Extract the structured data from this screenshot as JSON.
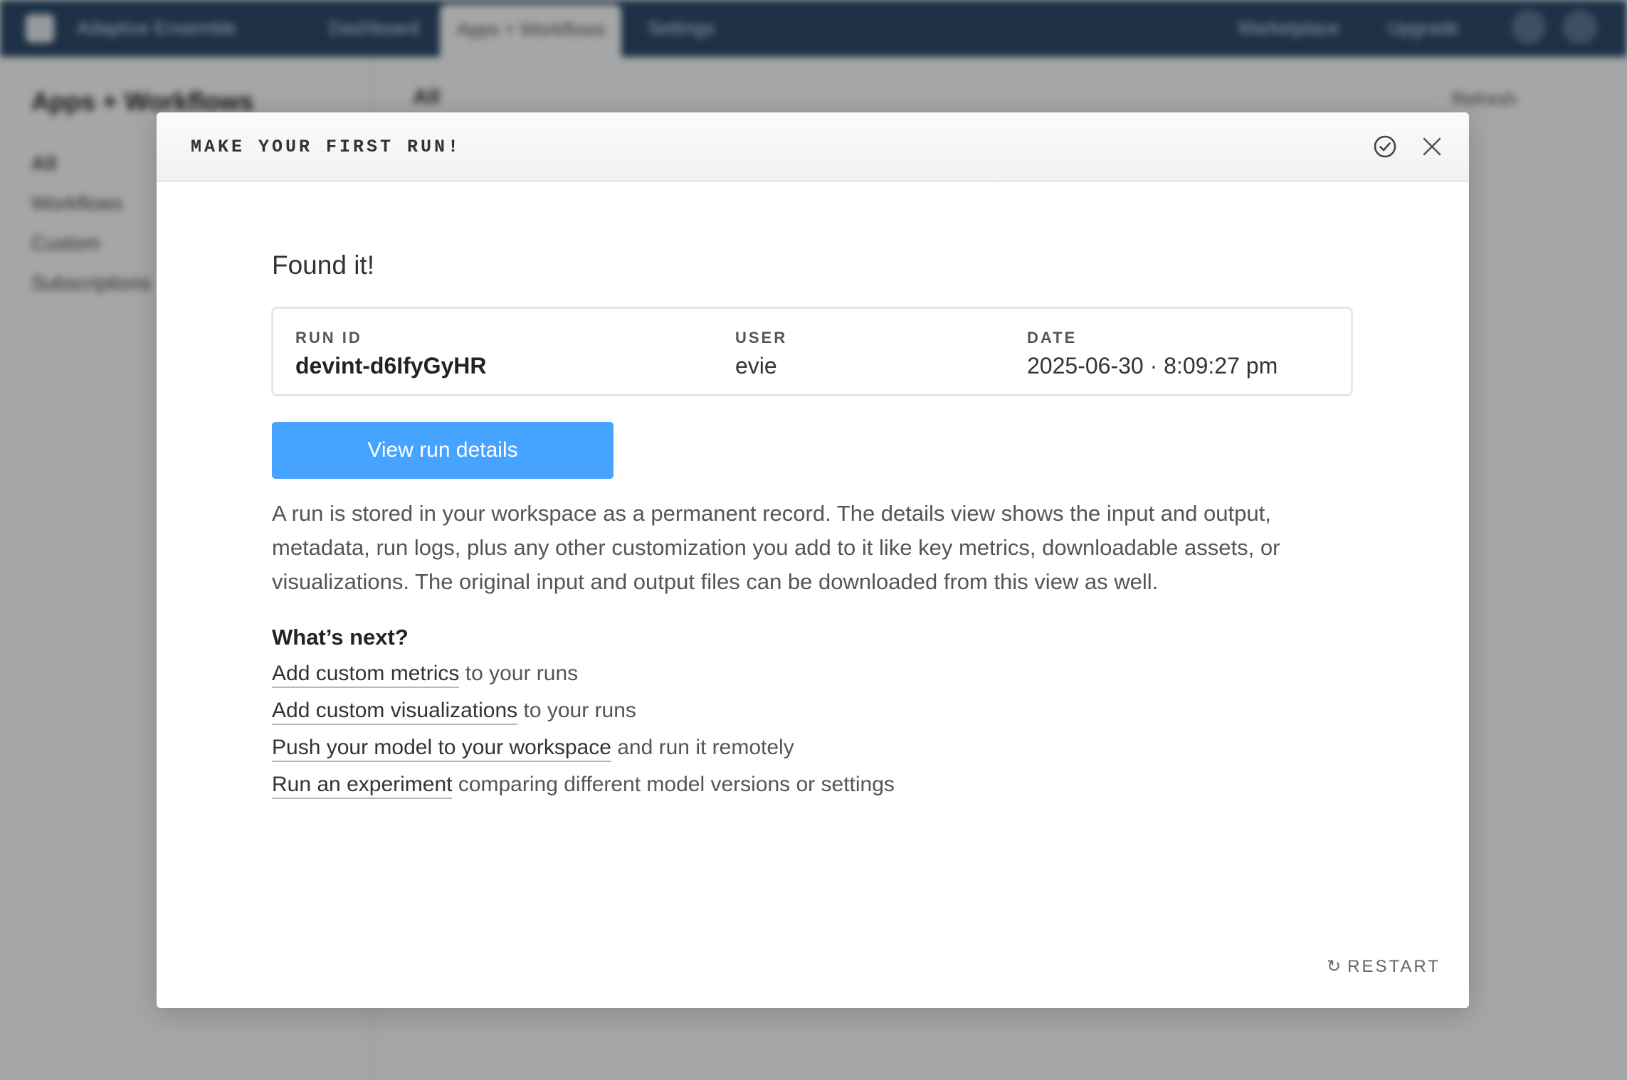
{
  "background": {
    "nav": {
      "workspace": "Adaptive Ensemble",
      "dashboard": "Dashboard",
      "active_tab": "Apps + Workflows",
      "settings": "Settings",
      "marketplace": "Marketplace",
      "upgrade": "Upgrade"
    },
    "page_title": "Apps + Workflows",
    "filter": "All",
    "refresh": "Refresh",
    "sidebar": [
      "All",
      "Workflows",
      "Custom",
      "Subscriptions"
    ]
  },
  "modal": {
    "title": "MAKE YOUR FIRST RUN!",
    "heading": "Found it!",
    "run": {
      "id_label": "RUN ID",
      "id_value": "devint-d6IfyGyHR",
      "user_label": "USER",
      "user_value": "evie",
      "date_label": "DATE",
      "date_value": "2025-06-30 · 8:09:27 pm"
    },
    "primary_button": "View run details",
    "description": [
      "A run is stored in your workspace as a permanent record. The details view shows the input and output,",
      "metadata, run logs, plus any other customization you add to it like key metrics, downloadable assets, or",
      "visualizations. The original input and output files can be downloaded from this view as well."
    ],
    "next_heading": "What’s next?",
    "next_items": [
      {
        "link": "Add custom metrics",
        "rest": " to your runs"
      },
      {
        "link": "Add custom visualizations",
        "rest": " to your runs"
      },
      {
        "link": "Push your model to your workspace",
        "rest": " and run it remotely"
      },
      {
        "link": "Run an experiment",
        "rest": " comparing different model versions or settings"
      }
    ],
    "restart": "RESTART"
  },
  "icons": {
    "complete": "check-circle-icon",
    "close": "close-icon",
    "restart": "refresh-icon"
  },
  "colors": {
    "nav_bg": "#2b4868",
    "primary": "#46a3ff"
  }
}
